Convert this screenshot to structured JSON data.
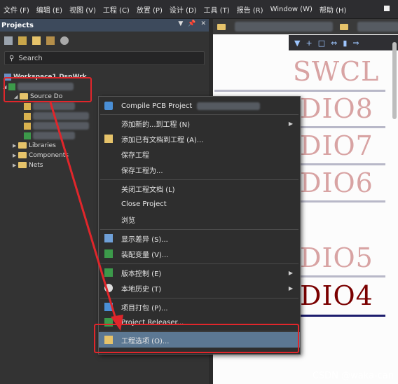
{
  "menubar": {
    "items": [
      "文件 (F)",
      "编辑 (E)",
      "视图 (V)",
      "工程 (C)",
      "放置 (P)",
      "设计 (D)",
      "工具 (T)",
      "报告 (R)",
      "Window (W)",
      "帮助 (H)"
    ]
  },
  "panel": {
    "title": "Projects",
    "search_placeholder": "Search",
    "workspace_label": "Workspace1.DsnWrk",
    "project_folder_label": "Source Do",
    "tree_items": [
      "Libraries",
      "Components",
      "Nets"
    ]
  },
  "schematic": {
    "labels": [
      "SWCL",
      "DIO8",
      "DIO7",
      "DIO6",
      "DIO5",
      "DIO4"
    ]
  },
  "context_menu": {
    "items": [
      {
        "label": "Compile PCB Project",
        "icon": "compile-icon",
        "submenu": false
      },
      {
        "label": "添加新的...到工程 (N)",
        "icon": "",
        "submenu": true
      },
      {
        "label": "添加已有文档到工程 (A)...",
        "icon": "add-existing-icon",
        "submenu": false
      },
      {
        "label": "保存工程",
        "icon": "",
        "submenu": false
      },
      {
        "label": "保存工程为...",
        "icon": "",
        "submenu": false
      },
      {
        "label": "关闭工程文档 (L)",
        "icon": "",
        "submenu": false
      },
      {
        "label": "Close Project",
        "icon": "",
        "submenu": false
      },
      {
        "label": "浏览",
        "icon": "",
        "submenu": false
      },
      {
        "label": "显示差异 (S)...",
        "icon": "diff-icon",
        "submenu": false
      },
      {
        "label": "装配变量 (V)...",
        "icon": "variant-icon",
        "submenu": false
      },
      {
        "label": "版本控制 (E)",
        "icon": "version-control-icon",
        "submenu": true
      },
      {
        "label": "本地历史 (T)",
        "icon": "history-icon",
        "submenu": true
      },
      {
        "label": "项目打包 (P)...",
        "icon": "package-icon",
        "submenu": false
      },
      {
        "label": "Project Releaser...",
        "icon": "releaser-icon",
        "submenu": false
      },
      {
        "label": "工程选项 (O)...",
        "icon": "project-options-icon",
        "submenu": false
      }
    ]
  },
  "watermark": "CSDN @waka-can",
  "colors": {
    "highlight": "#5c7893",
    "annotation_red": "#e0262b",
    "panel_header": "#3d4a5c"
  }
}
